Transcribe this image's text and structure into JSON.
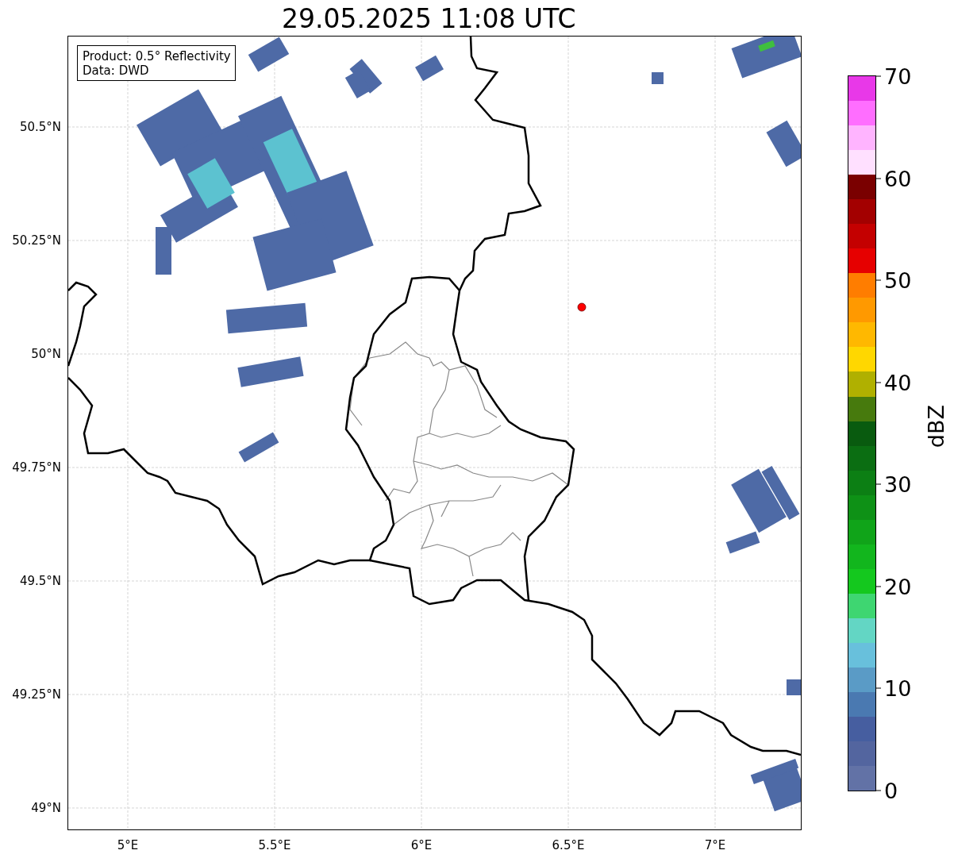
{
  "title": "29.05.2025 11:08 UTC",
  "info_box": [
    "Product: 0.5° Reflectivity",
    "Data: DWD"
  ],
  "lat_ticks": [
    "50.5°N",
    "50.25°N",
    "50°N",
    "49.75°N",
    "49.5°N",
    "49.25°N",
    "49°N"
  ],
  "lon_ticks": [
    "5°E",
    "5.5°E",
    "6°E",
    "6.5°E",
    "7°E"
  ],
  "colorbar": {
    "label": "dBZ",
    "ticks": [
      "70",
      "60",
      "50",
      "40",
      "30",
      "20",
      "10",
      "0"
    ],
    "segments": [
      {
        "color": "#6272a6"
      },
      {
        "color": "#53659f"
      },
      {
        "color": "#465ea0"
      },
      {
        "color": "#4a79b1"
      },
      {
        "color": "#5a9bc6"
      },
      {
        "color": "#68c0dc"
      },
      {
        "color": "#63d6c4"
      },
      {
        "color": "#3ed671"
      },
      {
        "color": "#14c81e"
      },
      {
        "color": "#12b61d"
      },
      {
        "color": "#10a419"
      },
      {
        "color": "#0e9116"
      },
      {
        "color": "#0c7f14"
      },
      {
        "color": "#0b6e12"
      },
      {
        "color": "#095b0f"
      },
      {
        "color": "#477a0d"
      },
      {
        "color": "#b0b000"
      },
      {
        "color": "#ffd700"
      },
      {
        "color": "#ffb800"
      },
      {
        "color": "#ff9900"
      },
      {
        "color": "#ff7d00"
      },
      {
        "color": "#e60000"
      },
      {
        "color": "#c40000"
      },
      {
        "color": "#a30000"
      },
      {
        "color": "#7a0000"
      },
      {
        "color": "#ffe0ff"
      },
      {
        "color": "#ffb4ff"
      },
      {
        "color": "#ff6eff"
      },
      {
        "color": "#e838e8"
      }
    ]
  }
}
